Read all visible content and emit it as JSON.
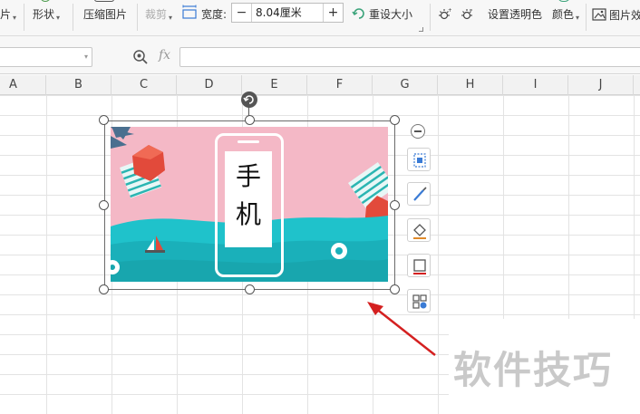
{
  "toolbar": {
    "partial_left_label": "片",
    "shape_label": "形状",
    "compress_label": "压缩图片",
    "crop_label": "裁剪",
    "width_label": "宽度:",
    "width_value": "8.04厘米",
    "width_minus": "−",
    "width_plus": "+",
    "reset_size_label": "重设大小",
    "set_transparent_label": "设置透明色",
    "color_label": "颜色",
    "picture_effect_label": "图片效"
  },
  "formula_bar": {
    "fx_label": "fx",
    "name_box_value": "",
    "formula_value": ""
  },
  "columns": [
    "A",
    "B",
    "C",
    "D",
    "E",
    "F",
    "G",
    "H",
    "I",
    "J"
  ],
  "picture": {
    "text_line1": "手",
    "text_line2": "机"
  },
  "float_toolbar": {
    "icons": [
      "layout-options-icon",
      "crop-brush-icon",
      "fill-icon",
      "border-icon",
      "more-picture-tools-icon"
    ]
  },
  "watermark": "软件技巧",
  "colors": {
    "accent_arrow": "#d42020",
    "picture_pink": "#f4b8c6",
    "picture_teal": "#1fc2cb"
  }
}
